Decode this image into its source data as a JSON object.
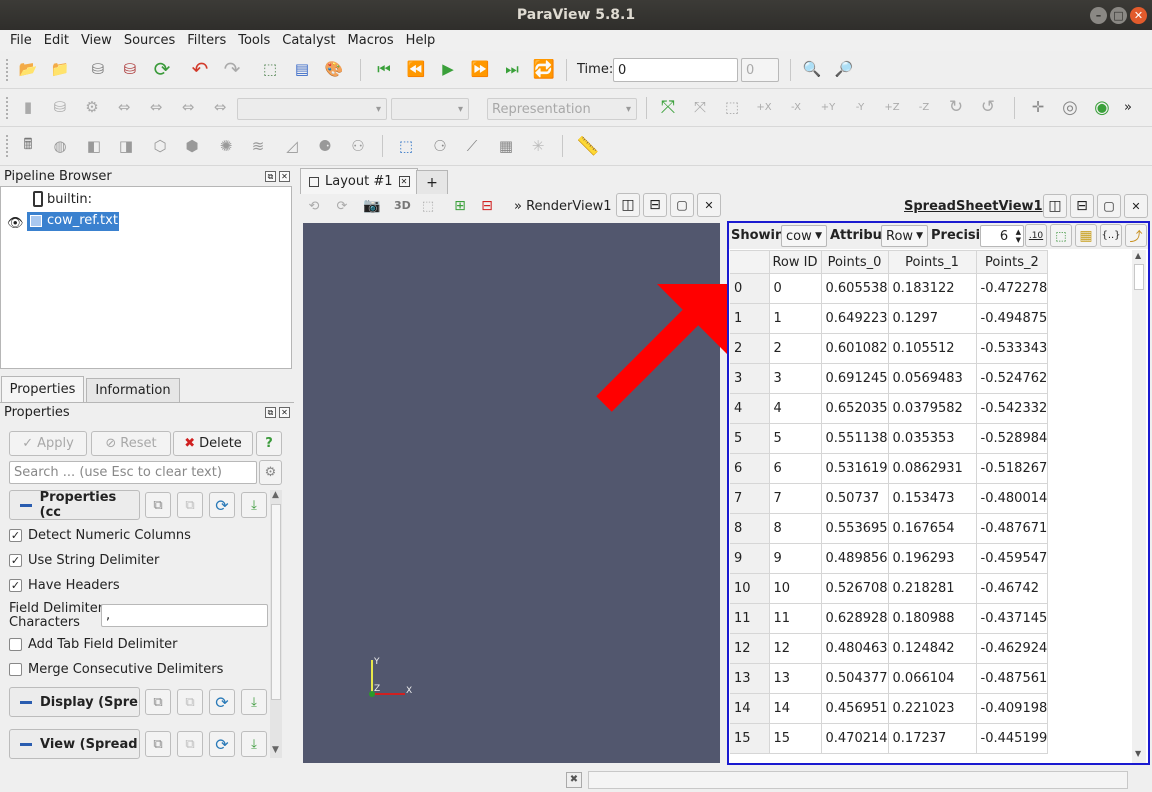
{
  "window": {
    "title": "ParaView 5.8.1"
  },
  "menu": [
    "File",
    "Edit",
    "View",
    "Sources",
    "Filters",
    "Tools",
    "Catalyst",
    "Macros",
    "Help"
  ],
  "time_toolbar": {
    "label": "Time:",
    "value": "0",
    "index": "0"
  },
  "representation": {
    "placeholder": "Representation"
  },
  "pipeline": {
    "title": "Pipeline Browser",
    "items": [
      {
        "label": "builtin:",
        "icon": "server-icon"
      },
      {
        "label": "cow_ref.txt",
        "icon": "table-icon",
        "selected": true
      }
    ]
  },
  "properties_tabs": [
    "Properties",
    "Information"
  ],
  "properties": {
    "title": "Properties",
    "apply": "Apply",
    "reset": "Reset",
    "delete": "Delete",
    "help": "?",
    "search_placeholder": "Search ... (use Esc to clear text)",
    "sections": {
      "properties": "Properties (cc",
      "display": "Display (Spre",
      "view": "View (Spread"
    },
    "checkboxes": [
      {
        "label": "Detect Numeric Columns",
        "checked": true
      },
      {
        "label": "Use String Delimiter",
        "checked": true
      },
      {
        "label": "Have Headers",
        "checked": true
      }
    ],
    "field_delimiter": {
      "label1": "Field Delimiter",
      "label2": "Characters",
      "value": ","
    },
    "checkboxes2": [
      {
        "label": "Add Tab Field Delimiter",
        "checked": false
      },
      {
        "label": "Merge Consecutive Delimiters",
        "checked": false
      }
    ]
  },
  "layout": {
    "tab": "Layout #1",
    "add_tab": "+",
    "render_view_label": "RenderView1",
    "btn_3d": "3D",
    "axes": {
      "x": "X",
      "y": "Y",
      "z": "Z"
    }
  },
  "spreadsheet": {
    "title": "SpreadSheetView1",
    "showing_label": "Showin",
    "showing_value": "cow",
    "attribute_label": "Attribu",
    "attribute_value": "Row",
    "precision_label": "Precisi",
    "precision_value": "6",
    "fixed_rep": ".10",
    "columns": [
      "Row ID",
      "Points_0",
      "Points_1",
      "Points_2"
    ],
    "rows": [
      [
        "0",
        "0",
        "0.605538",
        "0.183122",
        "-0.472278"
      ],
      [
        "1",
        "1",
        "0.649223",
        "0.1297",
        "-0.494875"
      ],
      [
        "2",
        "2",
        "0.601082",
        "0.105512",
        "-0.533343"
      ],
      [
        "3",
        "3",
        "0.691245",
        "0.0569483",
        "-0.524762"
      ],
      [
        "4",
        "4",
        "0.652035",
        "0.0379582",
        "-0.542332"
      ],
      [
        "5",
        "5",
        "0.551138",
        "0.035353",
        "-0.528984"
      ],
      [
        "6",
        "6",
        "0.531619",
        "0.0862931",
        "-0.518267"
      ],
      [
        "7",
        "7",
        "0.50737",
        "0.153473",
        "-0.480014"
      ],
      [
        "8",
        "8",
        "0.553695",
        "0.167654",
        "-0.487671"
      ],
      [
        "9",
        "9",
        "0.489856",
        "0.196293",
        "-0.459547"
      ],
      [
        "10",
        "10",
        "0.526708",
        "0.218281",
        "-0.46742"
      ],
      [
        "11",
        "11",
        "0.628928",
        "0.180988",
        "-0.437145"
      ],
      [
        "12",
        "12",
        "0.480463",
        "0.124842",
        "-0.462924"
      ],
      [
        "13",
        "13",
        "0.504377",
        "0.066104",
        "-0.487561"
      ],
      [
        "14",
        "14",
        "0.456951",
        "0.221023",
        "-0.409198"
      ],
      [
        "15",
        "15",
        "0.470214",
        "0.17237",
        "-0.445199"
      ]
    ]
  },
  "colors": {
    "render_bg": "#52576e",
    "selection": "#3a81cf",
    "active_view_border": "#1a1ad0",
    "annotation_arrow": "#ff0000"
  }
}
